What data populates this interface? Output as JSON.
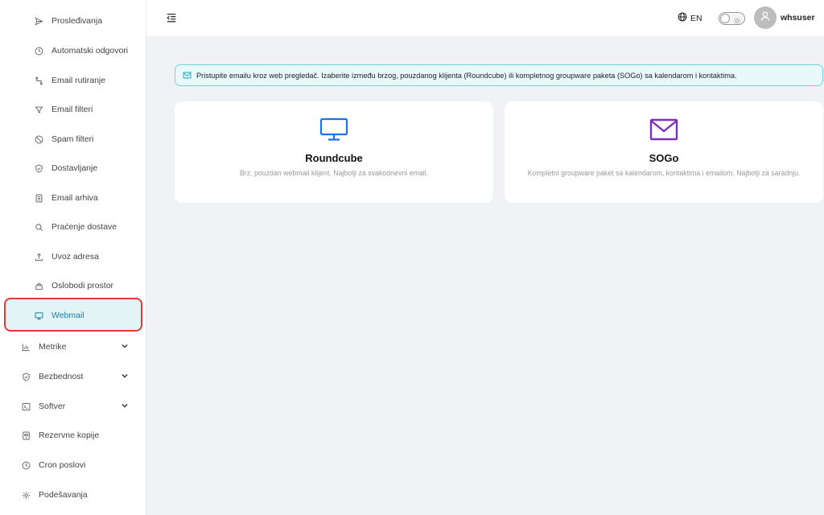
{
  "sidebar": {
    "sub_items": [
      {
        "label": "Prosleđivanja",
        "icon": "send-icon"
      },
      {
        "label": "Automatski odgovori",
        "icon": "clock-icon"
      },
      {
        "label": "Email rutiranje",
        "icon": "route-icon"
      },
      {
        "label": "Email filteri",
        "icon": "filter-icon"
      },
      {
        "label": "Spam filteri",
        "icon": "ban-icon"
      },
      {
        "label": "Dostavljanje",
        "icon": "shield-icon"
      },
      {
        "label": "Email arhiva",
        "icon": "archive-icon"
      },
      {
        "label": "Praćenje dostave",
        "icon": "search-icon"
      },
      {
        "label": "Uvoz adresa",
        "icon": "upload-icon"
      },
      {
        "label": "Oslobodi prostor",
        "icon": "cleanup-icon"
      },
      {
        "label": "Webmail",
        "icon": "monitor-icon",
        "active": true
      }
    ],
    "top_items": [
      {
        "label": "Metrike",
        "icon": "chart-icon",
        "expandable": true
      },
      {
        "label": "Bezbednost",
        "icon": "shield-icon",
        "expandable": true
      },
      {
        "label": "Softver",
        "icon": "terminal-icon",
        "expandable": true
      },
      {
        "label": "Rezervne kopije",
        "icon": "backup-icon"
      },
      {
        "label": "Cron poslovi",
        "icon": "clock-icon"
      },
      {
        "label": "Podešavanja",
        "icon": "gear-icon"
      }
    ]
  },
  "header": {
    "language": "EN",
    "username": "whsuser"
  },
  "info_banner": {
    "text": "Pristupite emailu kroz web pregledač. Izaberite između brzog, pouzdanog klijenta (Roundcube) ili kompletnog groupware paketa (SOGo) sa kalendarom i kontaktima."
  },
  "cards": [
    {
      "title": "Roundcube",
      "description": "Brz, pouzdan webmail klijent. Najbolji za svakodnevni email.",
      "icon": "monitor-icon",
      "color": "#1a73e8"
    },
    {
      "title": "SOGo",
      "description": "Kompletni groupware paket sa kalendarom, kontaktima i emailom. Najbolji za saradnju.",
      "icon": "envelope-icon",
      "color": "#7b2fbe"
    }
  ],
  "colors": {
    "accent": "#1c7ea3",
    "active_bg": "#e3f4f7",
    "highlight_border": "#e53935",
    "info_border": "#74d3e0"
  }
}
